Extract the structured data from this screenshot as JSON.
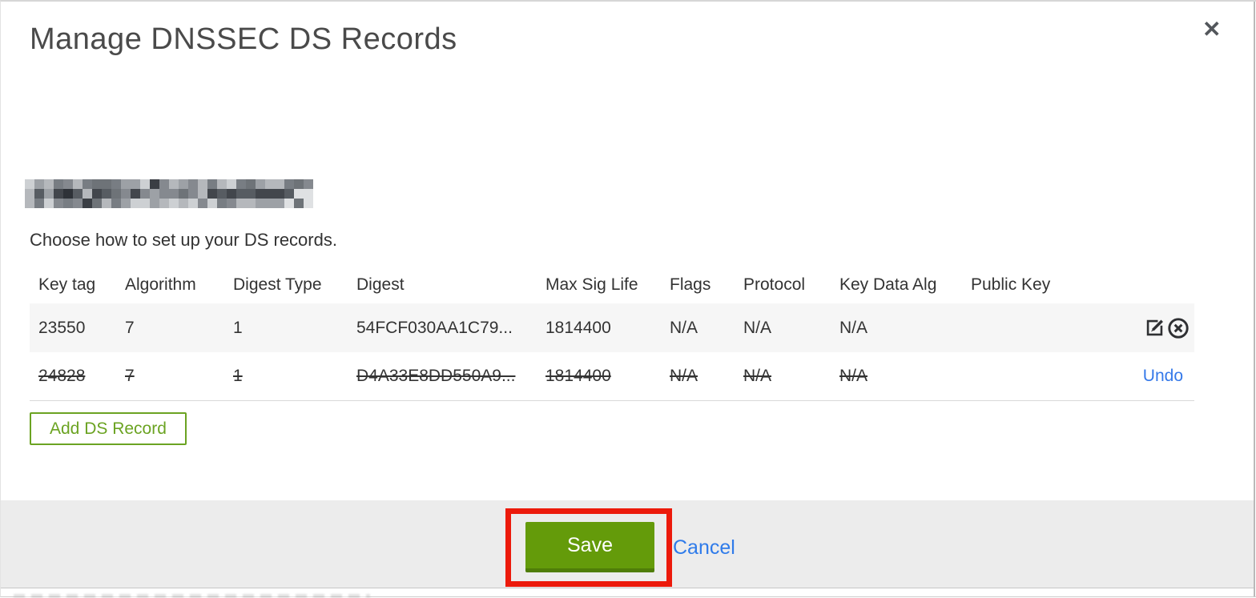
{
  "modal": {
    "title": "Manage DNSSEC DS Records",
    "instruction": "Choose how to set up your DS records.",
    "close_icon": "✕"
  },
  "table": {
    "headers": [
      "Key tag",
      "Algorithm",
      "Digest Type",
      "Digest",
      "Max Sig Life",
      "Flags",
      "Protocol",
      "Key Data Alg",
      "Public Key"
    ],
    "rows": [
      {
        "key_tag": "23550",
        "algorithm": "7",
        "digest_type": "1",
        "digest": "54FCF030AA1C79...",
        "max_sig_life": "1814400",
        "flags": "N/A",
        "protocol": "N/A",
        "key_data_alg": "N/A",
        "public_key": "",
        "state": "normal",
        "actions": [
          "edit",
          "delete"
        ]
      },
      {
        "key_tag": "24828",
        "algorithm": "7",
        "digest_type": "1",
        "digest": "D4A33E8DD550A9...",
        "max_sig_life": "1814400",
        "flags": "N/A",
        "protocol": "N/A",
        "key_data_alg": "N/A",
        "public_key": "",
        "state": "deleted",
        "undo_label": "Undo"
      }
    ]
  },
  "buttons": {
    "add_record": "Add DS Record",
    "save": "Save",
    "cancel": "Cancel"
  },
  "icons": {
    "close": "x-icon",
    "edit": "pencil-square-icon",
    "delete": "circle-x-icon"
  },
  "colors": {
    "accent_green": "#649b0a",
    "outline_green": "#6ba322",
    "link_blue": "#2f7bea",
    "annotation_red": "#ec1a0b",
    "footer_bg": "#ececec",
    "row_alt_bg": "#f6f6f6"
  }
}
